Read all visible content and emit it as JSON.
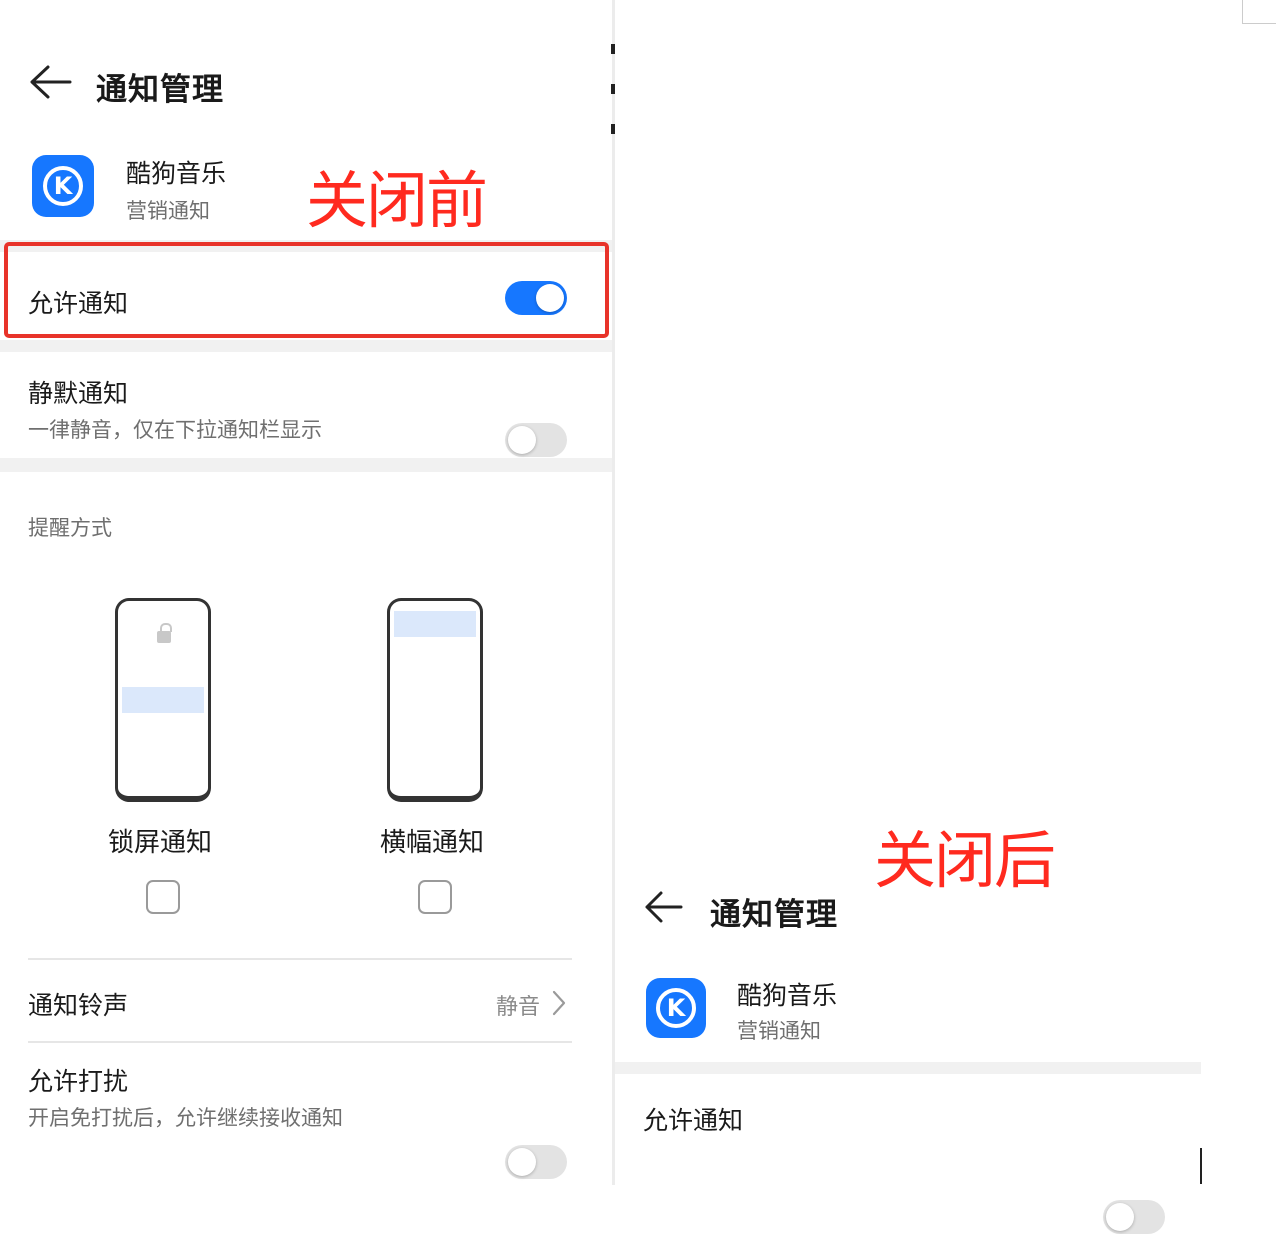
{
  "before": {
    "title": "通知管理",
    "app_name": "酷狗音乐",
    "app_category": "营销通知",
    "annotation": "关闭前",
    "allow_notifications": {
      "label": "允许通知",
      "enabled": true
    },
    "silent_notifications": {
      "label": "静默通知",
      "sub": "一律静音，仅在下拉通知栏显示",
      "enabled": false
    },
    "reminder_section": "提醒方式",
    "styles": [
      {
        "label": "锁屏通知",
        "checked": false
      },
      {
        "label": "横幅通知",
        "checked": false
      }
    ],
    "ringtone": {
      "label": "通知铃声",
      "value": "静音"
    },
    "dnd": {
      "label": "允许打扰",
      "sub": "开启免打扰后，允许继续接收通知",
      "enabled": false
    }
  },
  "after": {
    "annotation": "关闭后",
    "title": "通知管理",
    "app_name": "酷狗音乐",
    "app_category": "营销通知",
    "allow_notifications": {
      "label": "允许通知",
      "enabled": false
    }
  },
  "app_icon_letter": "K",
  "colors": {
    "accent": "#1677ff",
    "annotation_red": "#ff2a1f",
    "highlight_box": "#e8332a"
  }
}
